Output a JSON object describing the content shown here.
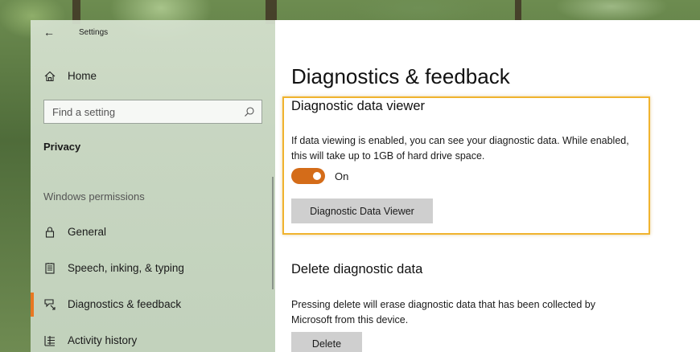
{
  "window": {
    "app_title": "Settings"
  },
  "sidebar": {
    "home_label": "Home",
    "search_placeholder": "Find a setting",
    "section_label": "Privacy",
    "group_label": "Windows permissions",
    "items": [
      {
        "label": "General",
        "icon": "lock-icon"
      },
      {
        "label": "Speech, inking, & typing",
        "icon": "speech-icon"
      },
      {
        "label": "Diagnostics & feedback",
        "icon": "diagnostics-icon",
        "active": true
      },
      {
        "label": "Activity history",
        "icon": "activity-icon"
      }
    ]
  },
  "main": {
    "page_title": "Diagnostics & feedback",
    "viewer_section": {
      "title": "Diagnostic data viewer",
      "description": "If data viewing is enabled, you can see your diagnostic data. While enabled, this will take up to 1GB of hard drive space.",
      "toggle_state": "On",
      "button_label": "Diagnostic Data Viewer"
    },
    "delete_section": {
      "title": "Delete diagnostic data",
      "description": "Pressing delete will erase diagnostic data that has been collected by Microsoft from this device.",
      "button_label": "Delete"
    }
  },
  "colors": {
    "accent": "#d46c19",
    "highlight_border": "#f0b32e"
  }
}
